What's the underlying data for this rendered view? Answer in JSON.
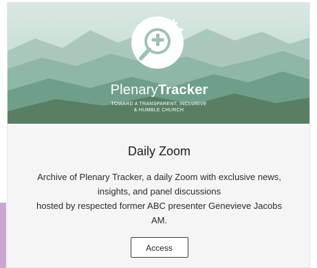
{
  "hero": {
    "brand_light": "Plenary",
    "brand_bold": "Tracker",
    "tagline_line1": "TOWARD A TRANSPARENT, INCLUSIVE",
    "tagline_line2": "& HUMBLE CHURCH"
  },
  "card": {
    "title": "Daily Zoom",
    "description_line1": "Archive of Plenary Tracker, a daily Zoom with exclusive news,",
    "description_line2": "insights, and panel discussions",
    "description_line3": "hosted by respected former ABC presenter Genevieve Jacobs",
    "description_line4": "AM.",
    "button_label": "Access"
  },
  "colors": {
    "card_background": "#f5f5f6",
    "side_strip": "#c9a6cf",
    "sky": "#cfe3dc"
  },
  "icons": {
    "logo": "magnifier-plus-icon"
  }
}
